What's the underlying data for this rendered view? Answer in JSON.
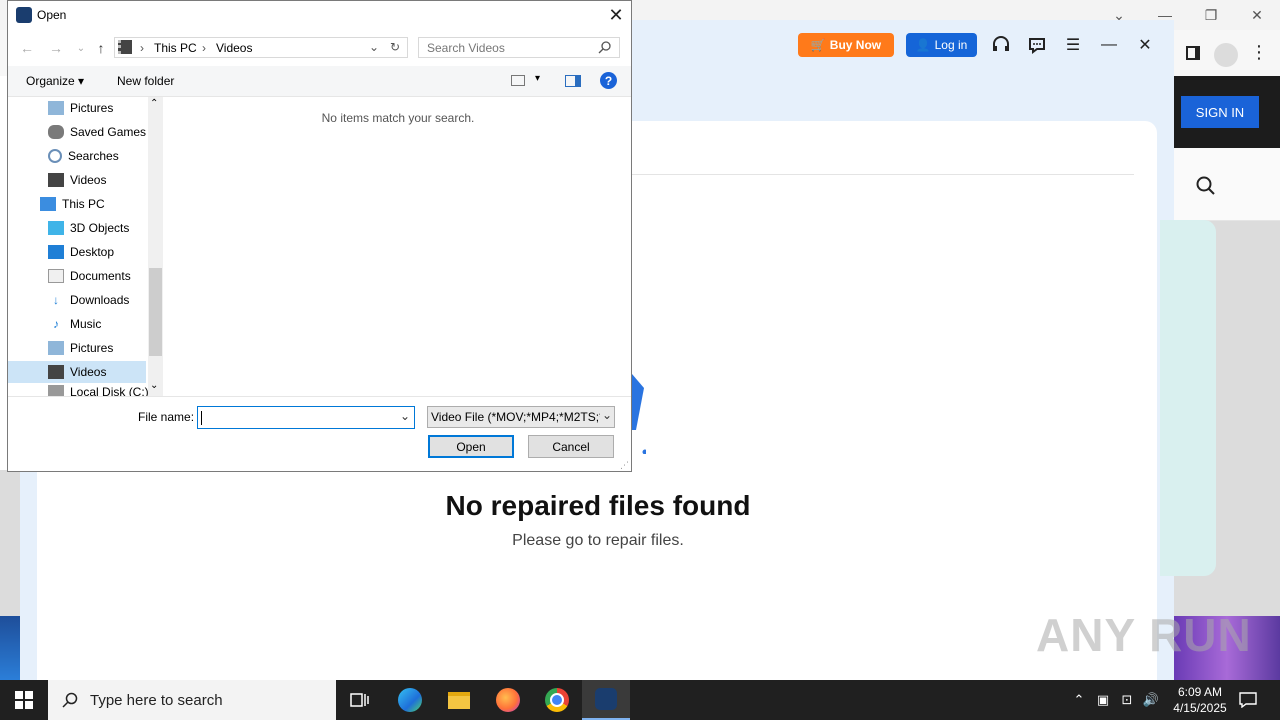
{
  "browser": {
    "sign_in": "SIGN IN"
  },
  "app": {
    "buy_now": "Buy Now",
    "log_in": "Log in",
    "empty_title": "No repaired files found",
    "empty_subtitle": "Please go to repair files."
  },
  "dialog": {
    "title": "Open",
    "breadcrumb": [
      "This PC",
      "Videos"
    ],
    "search_placeholder": "Search Videos",
    "toolbar": {
      "organize": "Organize",
      "new_folder": "New folder"
    },
    "nav_items": [
      {
        "label": "Pictures",
        "icon": "pictures-icon"
      },
      {
        "label": "Saved Games",
        "icon": "saved-games-icon"
      },
      {
        "label": "Searches",
        "icon": "searches-icon"
      },
      {
        "label": "Videos",
        "icon": "videos-icon"
      },
      {
        "label": "This PC",
        "icon": "this-pc-icon"
      },
      {
        "label": "3D Objects",
        "icon": "3d-objects-icon"
      },
      {
        "label": "Desktop",
        "icon": "desktop-icon"
      },
      {
        "label": "Documents",
        "icon": "documents-icon"
      },
      {
        "label": "Downloads",
        "icon": "downloads-icon"
      },
      {
        "label": "Music",
        "icon": "music-icon"
      },
      {
        "label": "Pictures",
        "icon": "pictures-icon"
      },
      {
        "label": "Videos",
        "icon": "videos-icon"
      },
      {
        "label": "Local Disk (C:)",
        "icon": "drive-icon"
      }
    ],
    "empty_message": "No items match your search.",
    "file_name_label": "File name:",
    "file_name_value": "",
    "file_type": "Video File (*MOV;*MP4;*M2TS;*",
    "open_button": "Open",
    "cancel_button": "Cancel"
  },
  "taskbar": {
    "search_placeholder": "Type here to search",
    "time": "6:09 AM",
    "date": "4/15/2025"
  },
  "watermark": "ANY RUN",
  "colors": {
    "accent": "#0078d7",
    "buy_now": "#ff7a1a",
    "login": "#1565d8"
  }
}
